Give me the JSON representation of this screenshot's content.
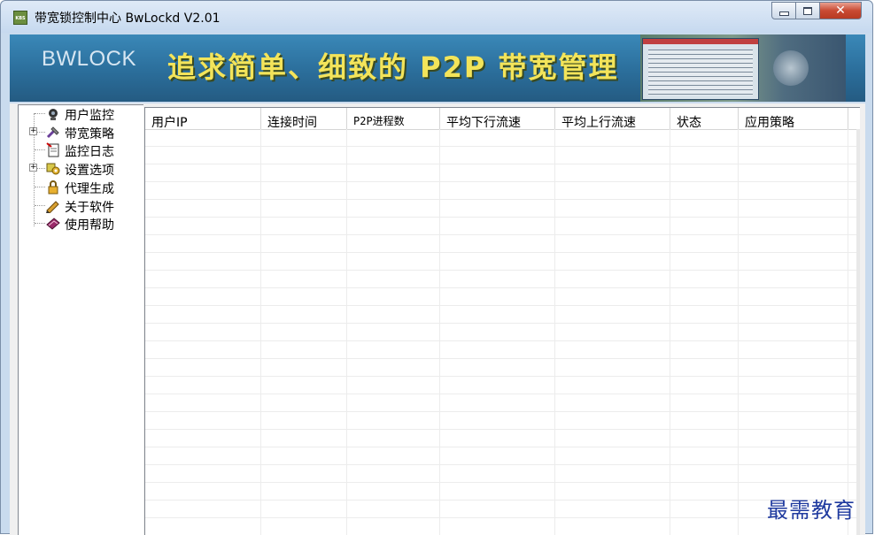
{
  "window": {
    "title": "带宽锁控制中心 BwLockd  V2.01",
    "app_icon_text": "KBS",
    "close_glyph": "✕"
  },
  "banner": {
    "brand": "BWLOCK",
    "slogan": "追求简单、细致的 P2P 带宽管理"
  },
  "tree": {
    "items": [
      {
        "label": "用户监控",
        "icon": "camera-icon",
        "expandable": false
      },
      {
        "label": "带宽策略",
        "icon": "tools-icon",
        "expandable": true
      },
      {
        "label": "监控日志",
        "icon": "document-icon",
        "expandable": false
      },
      {
        "label": "设置选项",
        "icon": "settings-icon",
        "expandable": true
      },
      {
        "label": "代理生成",
        "icon": "lock-icon",
        "expandable": false
      },
      {
        "label": "关于软件",
        "icon": "pencil-icon",
        "expandable": false
      },
      {
        "label": "使用帮助",
        "icon": "help-book-icon",
        "expandable": false
      }
    ]
  },
  "table": {
    "columns": [
      "用户IP",
      "连接时间",
      "P2P进程数",
      "平均下行流速",
      "平均上行流速",
      "状态",
      "应用策略"
    ],
    "rows": []
  },
  "watermark": "最需教育",
  "colors": {
    "banner": "#2b6e9b",
    "slogan": "#f3e45a",
    "close_button": "#c94a33",
    "watermark": "#1f3a9f"
  }
}
